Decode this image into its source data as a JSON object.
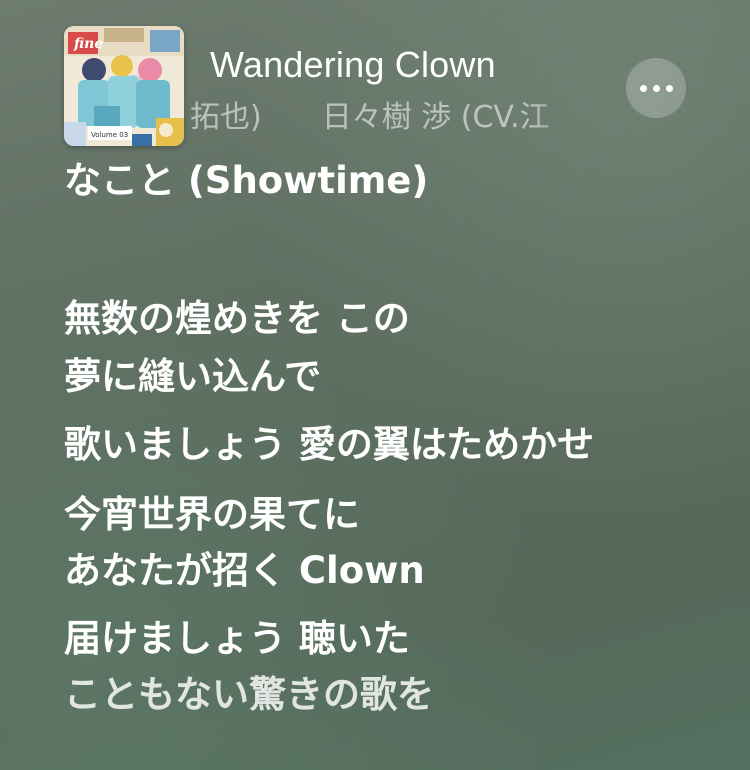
{
  "now_playing": {
    "title": "Wandering Clown",
    "artist_line_visible": "拓也)　　日々樹 渉 (CV.江"
  },
  "lyrics": {
    "prev_line": "なこと (Showtime)",
    "lines": [
      "無数の煌めきを この",
      "夢に縫い込んで",
      "歌いましょう 愛の翼はためかせ",
      "今宵世界の果てに",
      "あなたが招く Clown",
      "届けましょう 聴いた",
      "こともない驚きの歌を"
    ]
  },
  "album_art": {
    "icon": "album-cover-image",
    "text": "fine",
    "volume_label": "Volume 03"
  },
  "more_button": {
    "icon": "ellipsis-icon"
  },
  "colors": {
    "background": "#5e6e61",
    "lyric_active": "#ffffff",
    "artist_text": "rgba(255,255,255,0.55)"
  }
}
